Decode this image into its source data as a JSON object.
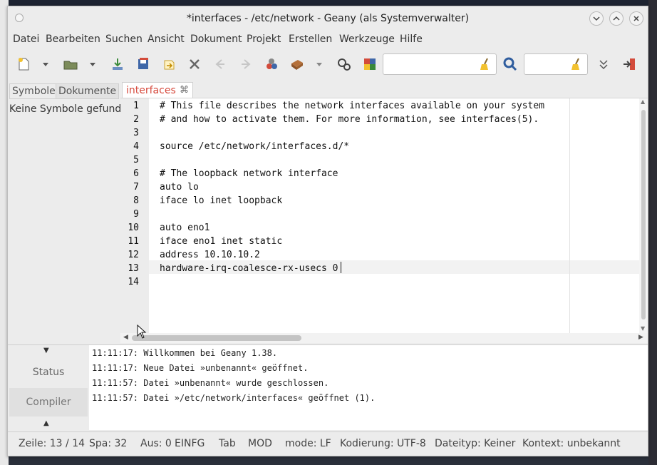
{
  "window": {
    "title": "*interfaces - /etc/network - Geany (als Systemverwalter)"
  },
  "menu": [
    "Datei",
    "Bearbeiten",
    "Suchen",
    "Ansicht",
    "Dokument",
    "Projekt",
    "Erstellen",
    "Werkzeuge",
    "Hilfe"
  ],
  "toolbar": {
    "search_value": "",
    "goto_value": ""
  },
  "sidebar": {
    "tabs": [
      "Symbole",
      "Dokumente"
    ],
    "empty_text": "Keine Symbole gefunden"
  },
  "editor": {
    "tab_label": "interfaces",
    "tab_close": "⌘",
    "line_numbers": [
      "1",
      "2",
      "3",
      "4",
      "5",
      "6",
      "7",
      "8",
      "9",
      "10",
      "11",
      "12",
      "13",
      "14"
    ],
    "lines": [
      "# This file describes the network interfaces available on your system",
      "# and how to activate them. For more information, see interfaces(5).",
      "",
      "source /etc/network/interfaces.d/*",
      "",
      "# The loopback network interface",
      "auto lo",
      "iface lo inet loopback",
      "",
      "auto eno1",
      "iface eno1 inet static",
      "address 10.10.10.2",
      "hardware-irq-coalesce-rx-usecs 0",
      ""
    ],
    "current_line": 13
  },
  "messages": {
    "tabs": [
      "Status",
      "Compiler"
    ],
    "lines": [
      "11:11:17: Willkommen bei Geany 1.38.",
      "11:11:17: Neue Datei »unbenannt« geöffnet.",
      "11:11:57: Datei »unbenannt« wurde geschlossen.",
      "11:11:57: Datei »/etc/network/interfaces« geöffnet (1)."
    ]
  },
  "statusbar": {
    "line": "Zeile: 13 / 14",
    "col": "Spa: 32",
    "sel": "Aus: 0",
    "insert": "EINFG",
    "indent": "Tab",
    "modified": "MOD",
    "eol": "mode: LF",
    "encoding": "Kodierung: UTF-8",
    "filetype": "Dateityp: Keiner",
    "scope": "Kontext: unbekannt"
  },
  "colors": {
    "tab_label": "#d6483b",
    "accent_blue": "#2f5d9e"
  }
}
